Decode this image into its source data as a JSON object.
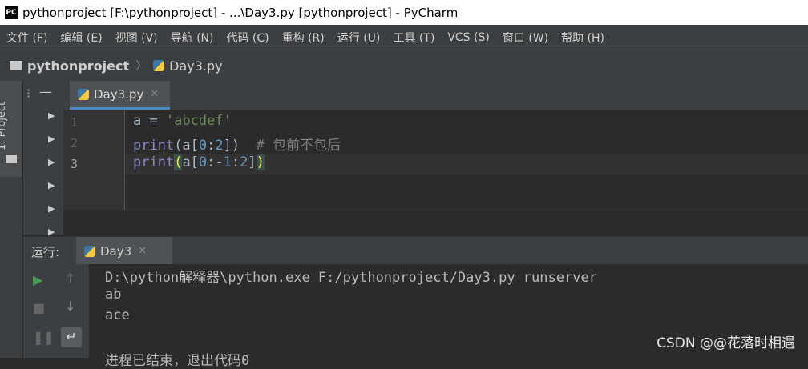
{
  "window": {
    "title": "pythonproject [F:\\pythonproject] - ...\\Day3.py [pythonproject] - PyCharm"
  },
  "menu": [
    "文件 (F)",
    "编辑 (E)",
    "视图 (V)",
    "导航 (N)",
    "代码 (C)",
    "重构 (R)",
    "运行 (U)",
    "工具 (T)",
    "VCS (S)",
    "窗口 (W)",
    "帮助 (H)"
  ],
  "breadcrumb": {
    "project": "pythonproject",
    "file": "Day3.py"
  },
  "sidebar": {
    "project_tab": "1: Project"
  },
  "editor": {
    "tab_label": "Day3.py",
    "line_numbers": [
      "1",
      "2",
      "3"
    ],
    "lines": [
      [
        {
          "t": "a = ",
          "c": ""
        },
        {
          "t": "'abcdef'",
          "c": "str"
        }
      ],
      [
        {
          "t": "print",
          "c": "fn"
        },
        {
          "t": "(a[",
          "c": ""
        },
        {
          "t": "0",
          "c": "num"
        },
        {
          "t": ":",
          "c": ""
        },
        {
          "t": "2",
          "c": "num"
        },
        {
          "t": "])",
          "c": ""
        },
        {
          "t": "  # 包前不包后",
          "c": "cmt"
        }
      ],
      [
        {
          "t": "print",
          "c": "fn"
        },
        {
          "t": "(",
          "c": "brk"
        },
        {
          "t": "a[",
          "c": ""
        },
        {
          "t": "0",
          "c": "num"
        },
        {
          "t": ":-",
          "c": ""
        },
        {
          "t": "1",
          "c": "num"
        },
        {
          "t": ":",
          "c": ""
        },
        {
          "t": "2",
          "c": "num"
        },
        {
          "t": "]",
          "c": ""
        },
        {
          "t": ")",
          "c": "brk"
        }
      ]
    ]
  },
  "run": {
    "label": "运行:",
    "tab_label": "Day3",
    "output": [
      "D:\\python解释器\\python.exe F:/pythonproject/Day3.py runserver",
      "ab",
      "ace",
      "",
      "进程已结束，退出代码0"
    ]
  },
  "watermark": "CSDN @@花落时相遇",
  "colors": {
    "accent": "#4a88c7",
    "run_green": "#499c54"
  }
}
